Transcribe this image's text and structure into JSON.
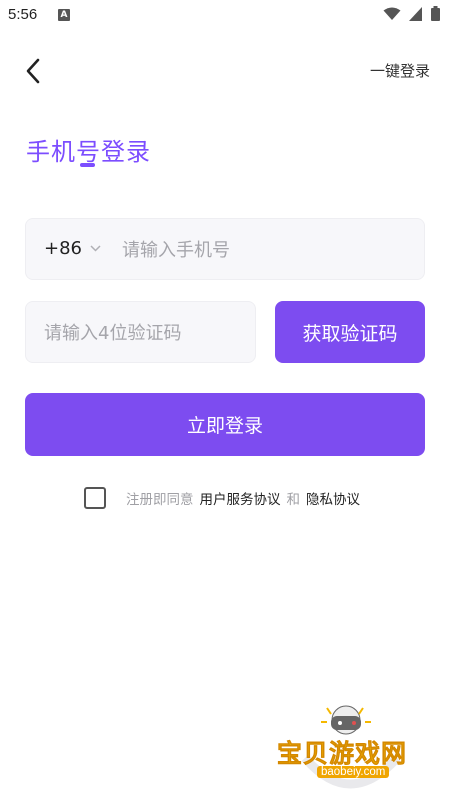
{
  "status_bar": {
    "time": "5:56",
    "notification_icon": "A",
    "icons": [
      "wifi-icon",
      "signal-icon",
      "battery-icon"
    ]
  },
  "header": {
    "back_icon": "chevron-left-icon",
    "quick_login_label": "一键登录"
  },
  "title": "手机号登录",
  "phone": {
    "country_code": "+86",
    "placeholder": "请输入手机号",
    "value": ""
  },
  "code": {
    "placeholder": "请输入4位验证码",
    "value": ""
  },
  "get_code_label": "获取验证码",
  "login_label": "立即登录",
  "agreement": {
    "checked": false,
    "prefix": "注册即同意",
    "terms_label": "用户服务协议",
    "conjunction": "和",
    "privacy_label": "隐私协议"
  },
  "watermark": {
    "name": "宝贝游戏网",
    "url": "baobeiy.com"
  },
  "colors": {
    "accent": "#7d4cf0",
    "input_bg": "#f7f7fa",
    "placeholder": "#a5a5ab"
  }
}
